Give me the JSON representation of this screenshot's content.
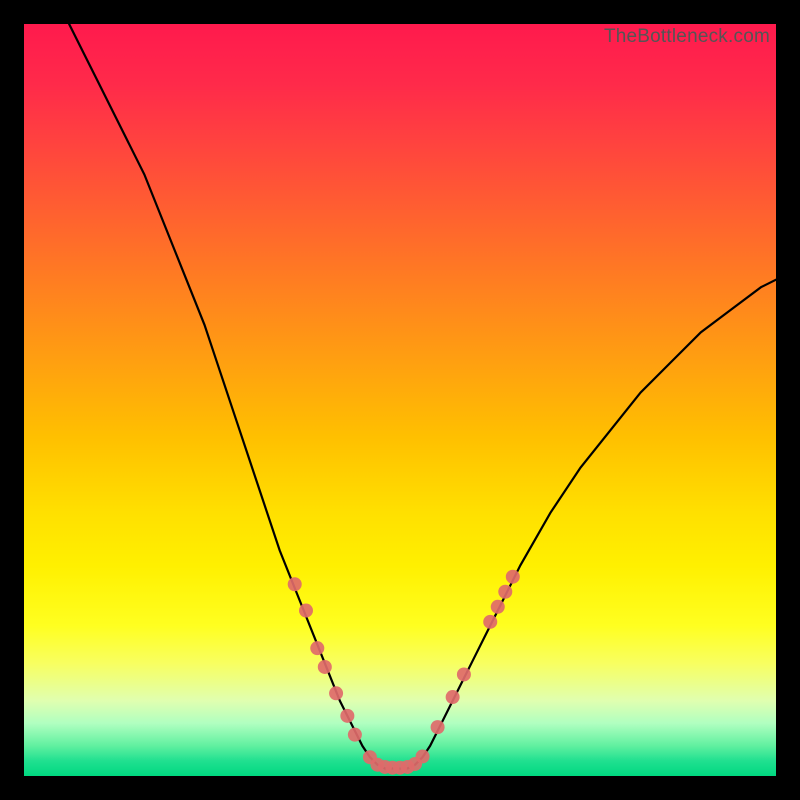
{
  "watermark": "TheBottleneck.com",
  "chart_data": {
    "type": "line",
    "title": "",
    "xlabel": "",
    "ylabel": "",
    "xlim": [
      0,
      100
    ],
    "ylim": [
      0,
      100
    ],
    "series": [
      {
        "name": "bottleneck-curve",
        "x": [
          6,
          8,
          10,
          12,
          14,
          16,
          18,
          20,
          22,
          24,
          26,
          28,
          30,
          32,
          34,
          36,
          38,
          40,
          42,
          44,
          45,
          46,
          47,
          48,
          49,
          50,
          51,
          52,
          53,
          54,
          56,
          58,
          60,
          62,
          64,
          66,
          70,
          74,
          78,
          82,
          86,
          90,
          94,
          98,
          100
        ],
        "y": [
          100,
          96,
          92,
          88,
          84,
          80,
          75,
          70,
          65,
          60,
          54,
          48,
          42,
          36,
          30,
          25,
          20,
          15,
          10,
          6,
          4,
          2.5,
          1.5,
          1,
          1,
          1,
          1,
          1.5,
          2.5,
          4,
          8,
          12,
          16,
          20,
          24,
          28,
          35,
          41,
          46,
          51,
          55,
          59,
          62,
          65,
          66
        ]
      }
    ],
    "markers": [
      {
        "x": 36.0,
        "y": 25.5
      },
      {
        "x": 37.5,
        "y": 22.0
      },
      {
        "x": 39.0,
        "y": 17.0
      },
      {
        "x": 40.0,
        "y": 14.5
      },
      {
        "x": 41.5,
        "y": 11.0
      },
      {
        "x": 43.0,
        "y": 8.0
      },
      {
        "x": 44.0,
        "y": 5.5
      },
      {
        "x": 46.0,
        "y": 2.5
      },
      {
        "x": 47.0,
        "y": 1.5
      },
      {
        "x": 48.0,
        "y": 1.2
      },
      {
        "x": 49.0,
        "y": 1.1
      },
      {
        "x": 50.0,
        "y": 1.1
      },
      {
        "x": 51.0,
        "y": 1.2
      },
      {
        "x": 52.0,
        "y": 1.6
      },
      {
        "x": 53.0,
        "y": 2.6
      },
      {
        "x": 55.0,
        "y": 6.5
      },
      {
        "x": 57.0,
        "y": 10.5
      },
      {
        "x": 58.5,
        "y": 13.5
      },
      {
        "x": 62.0,
        "y": 20.5
      },
      {
        "x": 63.0,
        "y": 22.5
      },
      {
        "x": 64.0,
        "y": 24.5
      },
      {
        "x": 65.0,
        "y": 26.5
      }
    ],
    "gradient_meaning": "vertical color gradient from red (high bottleneck) at top to green (no bottleneck) at bottom"
  }
}
